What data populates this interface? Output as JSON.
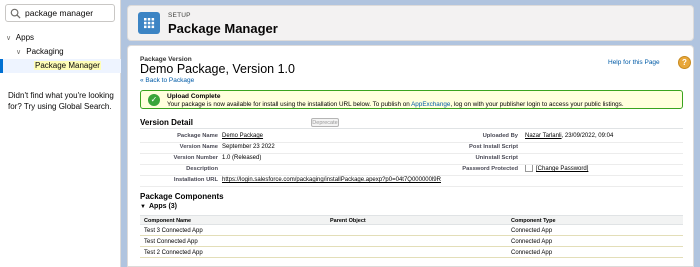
{
  "sidebar": {
    "search": {
      "value": "package manager",
      "placeholder": "Quick Find"
    },
    "tree": {
      "apps_label": "Apps",
      "packaging_label": "Packaging",
      "selected_label": "Package Manager"
    },
    "not_found_text": "Didn't find what you're looking for? Try using Global Search."
  },
  "header": {
    "eyebrow": "SETUP",
    "title": "Package Manager",
    "icon": "grid-icon"
  },
  "content": {
    "help_link": "Help for this Page",
    "package_version_label": "Package Version",
    "title": "Demo Package, Version 1.0",
    "back_link": "« Back to Package",
    "message": {
      "title": "Upload Complete",
      "body_before": "Your package is now available for install using the installation URL below. To publish on ",
      "body_link": "AppExchange",
      "body_after": ", log on with your publisher login to access your public listings."
    },
    "version_detail": {
      "title": "Version Detail",
      "deprecate_label": "Deprecate",
      "fields": {
        "package_name_label": "Package Name",
        "package_name": "Demo Package",
        "version_name_label": "Version Name",
        "version_name": "September 23 2022",
        "version_number_label": "Version Number",
        "version_number": "1.0 (Released)",
        "description_label": "Description",
        "installation_url_label": "Installation URL",
        "installation_url": "https://login.salesforce.com/packaging/installPackage.apexp?p0=04t7Q000000l9R",
        "uploaded_by_label": "Uploaded By",
        "uploaded_by_name": "Nazar Tarlanli",
        "uploaded_by_date": ", 23/09/2022, 09:04",
        "post_install_label": "Post Install Script",
        "uninstall_label": "Uninstall Script",
        "password_label": "Password Protected",
        "change_password": "[Change Password]"
      }
    },
    "components": {
      "title": "Package Components",
      "apps_group": "Apps (3)",
      "columns": [
        "Component Name",
        "Parent Object",
        "Component Type"
      ],
      "rows": [
        [
          "Test 3 Connected App",
          "",
          "Connected App"
        ],
        [
          "Test Connected App",
          "",
          "Connected App"
        ],
        [
          "Test 2 Connected App",
          "",
          "Connected App"
        ]
      ]
    }
  }
}
